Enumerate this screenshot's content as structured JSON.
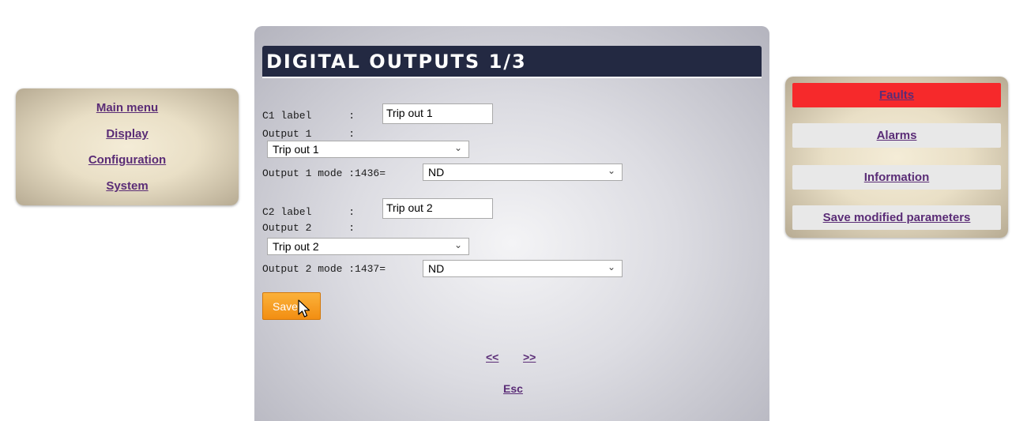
{
  "left_menu": {
    "items": [
      {
        "label": "Main menu"
      },
      {
        "label": "Display"
      },
      {
        "label": "Configuration"
      },
      {
        "label": "System"
      }
    ]
  },
  "page": {
    "title": "DIGITAL OUTPUTS 1/3"
  },
  "outputs": [
    {
      "label_text": "C1 label      :",
      "label_value": "Trip out 1",
      "output_text": "Output 1      :",
      "output_select": "Trip out 1",
      "mode_text": "Output 1 mode :1436=",
      "mode_select": "ND"
    },
    {
      "label_text": "C2 label      :",
      "label_value": "Trip out 2",
      "output_text": "Output 2      :",
      "output_select": "Trip out 2",
      "mode_text": "Output 2 mode :1437=",
      "mode_select": "ND"
    }
  ],
  "save_button": {
    "label": "Save"
  },
  "navigation": {
    "prev_label": "<<",
    "next_label": ">>",
    "esc_label": "Esc"
  },
  "right_menu": {
    "faults": "Faults",
    "alarms": "Alarms",
    "information": "Information",
    "save_params": "Save modified parameters",
    "faults_color": "#f6292b"
  }
}
